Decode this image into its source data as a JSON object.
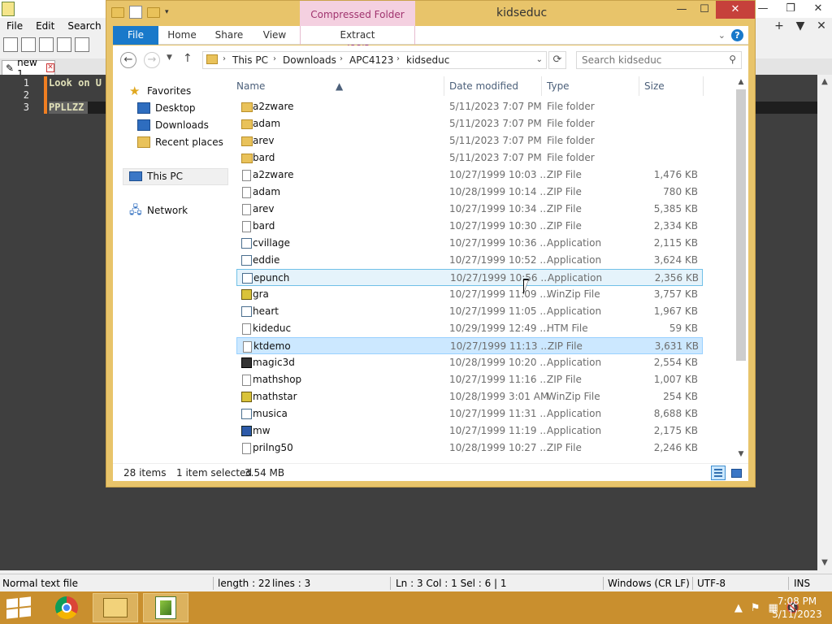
{
  "notepad": {
    "menu": [
      "File",
      "Edit",
      "Search",
      "V"
    ],
    "menu_right": [
      "+",
      "▼",
      "✕"
    ],
    "tab_label": "new 1",
    "lines": [
      {
        "num": "1",
        "text": "Look on U"
      },
      {
        "num": "2",
        "text": ""
      },
      {
        "num": "3",
        "text": "PPLLZZ"
      }
    ],
    "status": {
      "file_type": "Normal text file",
      "length": "length : 22",
      "lines": "lines : 3",
      "position": "Ln : 3    Col : 1    Sel : 6 | 1",
      "eol": "Windows (CR LF)",
      "encoding": "UTF-8",
      "mode": "INS"
    }
  },
  "explorer": {
    "title": "kidseduc",
    "context_tab": "Compressed Folder Tools",
    "ribbon_tabs": [
      "File",
      "Home",
      "Share",
      "View",
      "Extract"
    ],
    "address": [
      "This PC",
      "Downloads",
      "APC4123",
      "kidseduc"
    ],
    "search_placeholder": "Search kidseduc",
    "nav": {
      "favorites": "Favorites",
      "desktop": "Desktop",
      "downloads": "Downloads",
      "recent": "Recent places",
      "thispc": "This PC",
      "network": "Network"
    },
    "columns": [
      "Name",
      "Date modified",
      "Type",
      "Size"
    ],
    "files": [
      {
        "name": "a2zware",
        "date": "5/11/2023 7:07 PM",
        "type": "File folder",
        "size": "",
        "icon": "folder"
      },
      {
        "name": "adam",
        "date": "5/11/2023 7:07 PM",
        "type": "File folder",
        "size": "",
        "icon": "folder"
      },
      {
        "name": "arev",
        "date": "5/11/2023 7:07 PM",
        "type": "File folder",
        "size": "",
        "icon": "folder"
      },
      {
        "name": "bard",
        "date": "5/11/2023 7:07 PM",
        "type": "File folder",
        "size": "",
        "icon": "folder"
      },
      {
        "name": "a2zware",
        "date": "10/27/1999 10:03 ...",
        "type": "ZIP File",
        "size": "1,476 KB",
        "icon": "zip"
      },
      {
        "name": "adam",
        "date": "10/28/1999 10:14 ...",
        "type": "ZIP File",
        "size": "780 KB",
        "icon": "zip"
      },
      {
        "name": "arev",
        "date": "10/27/1999 10:34 ...",
        "type": "ZIP File",
        "size": "5,385 KB",
        "icon": "zip"
      },
      {
        "name": "bard",
        "date": "10/27/1999 10:30 ...",
        "type": "ZIP File",
        "size": "2,334 KB",
        "icon": "zip"
      },
      {
        "name": "cvillage",
        "date": "10/27/1999 10:36 ...",
        "type": "Application",
        "size": "2,115 KB",
        "icon": "app"
      },
      {
        "name": "eddie",
        "date": "10/27/1999 10:52 ...",
        "type": "Application",
        "size": "3,624 KB",
        "icon": "app"
      },
      {
        "name": "epunch",
        "date": "10/27/1999 10:56 ...",
        "type": "Application",
        "size": "2,356 KB",
        "icon": "app"
      },
      {
        "name": "gra",
        "date": "10/27/1999 11:09 ...",
        "type": "WinZip File",
        "size": "3,757 KB",
        "icon": "winzip"
      },
      {
        "name": "heart",
        "date": "10/27/1999 11:05 ...",
        "type": "Application",
        "size": "1,967 KB",
        "icon": "app"
      },
      {
        "name": "kideduc",
        "date": "10/29/1999 12:49 ...",
        "type": "HTM File",
        "size": "59 KB",
        "icon": "htm"
      },
      {
        "name": "ktdemo",
        "date": "10/27/1999 11:13 ...",
        "type": "ZIP File",
        "size": "3,631 KB",
        "icon": "zip"
      },
      {
        "name": "magic3d",
        "date": "10/28/1999 10:20 ...",
        "type": "Application",
        "size": "2,554 KB",
        "icon": "appmagic"
      },
      {
        "name": "mathshop",
        "date": "10/27/1999 11:16 ...",
        "type": "ZIP File",
        "size": "1,007 KB",
        "icon": "zip"
      },
      {
        "name": "mathstar",
        "date": "10/28/1999 3:01 AM",
        "type": "WinZip File",
        "size": "254 KB",
        "icon": "winzip"
      },
      {
        "name": "musica",
        "date": "10/27/1999 11:31 ...",
        "type": "Application",
        "size": "8,688 KB",
        "icon": "app"
      },
      {
        "name": "mw",
        "date": "10/27/1999 11:19 ...",
        "type": "Application",
        "size": "2,175 KB",
        "icon": "appmw"
      },
      {
        "name": "prilng50",
        "date": "10/28/1999 10:27 ...",
        "type": "ZIP File",
        "size": "2,246 KB",
        "icon": "zip"
      }
    ],
    "hover_index": 10,
    "selected_index": 14,
    "status": {
      "count": "28 items",
      "selection": "1 item selected",
      "size": "3.54 MB"
    }
  },
  "taskbar": {
    "time": "7:08 PM",
    "date": "5/11/2023"
  },
  "colors": {
    "explorer_frame": "#e8c46a",
    "accent": "#1979ca",
    "taskbar": "#c98f2e",
    "close": "#c6413b"
  }
}
